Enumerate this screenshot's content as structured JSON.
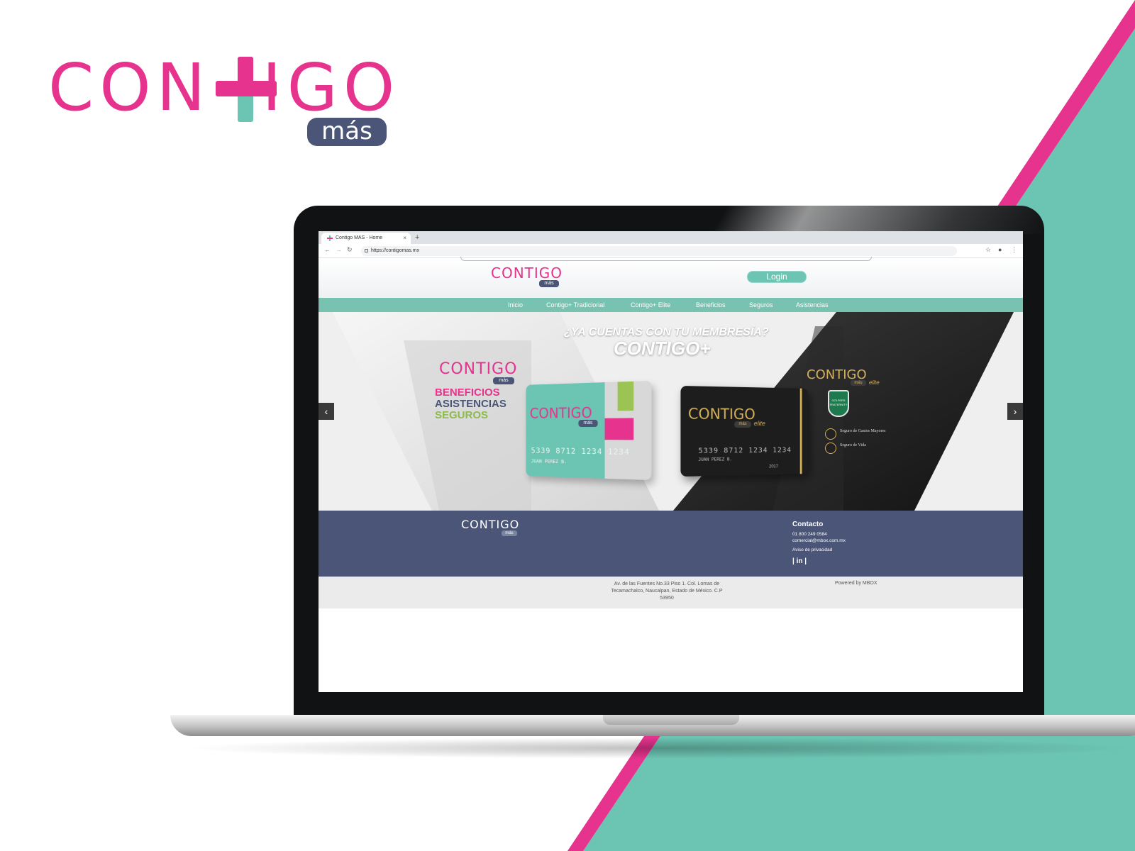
{
  "brand": {
    "word_left": "CON",
    "word_right": "IGO",
    "sub": "más"
  },
  "colors": {
    "pink": "#e5338e",
    "teal": "#6cc4b3",
    "navy": "#4a5577",
    "nav_teal": "#77c2b0",
    "gold": "#d4b05a"
  },
  "browser": {
    "tab_title": "Contigo MAS - Home",
    "tab_close": "×",
    "new_tab": "+",
    "url": "https://contigomas.mx",
    "icons": [
      "back-arrow-icon",
      "forward-arrow-icon",
      "reload-icon",
      "lock-icon",
      "star-icon",
      "account-icon",
      "menu-dots-icon"
    ]
  },
  "site": {
    "logo": "CONTIGO",
    "logo_sub": "más",
    "login": "Login",
    "nav": [
      "Inicio",
      "Contigo+ Tradicional",
      "Contigo+ Elite",
      "Beneficios",
      "Seguros",
      "Asistencias"
    ]
  },
  "hero": {
    "question": "¿YA CUENTAS CON TU MEMBRESÍA?",
    "title": "CONTIGO+",
    "left_logo": "CONTIGO",
    "left_sub": "más",
    "benefits": [
      "BENEFICIOS",
      "ASISTENCIAS",
      "SEGUROS"
    ],
    "teal_card": {
      "logo": "CONTIGO",
      "sub": "más",
      "number": "5339 8712 1234 1234",
      "name": "JUAN PEREZ B."
    },
    "black_card": {
      "logo": "CONTIGO",
      "sub": "más",
      "tier": "elite",
      "number": "5339 8712 1234 1234",
      "name": "JUAN PEREZ B.",
      "year": "2017"
    },
    "right_logo": "CONTIGO",
    "right_sub": "más",
    "right_tier": "elite",
    "golf_badge": "GOLFERS FRATERNITY",
    "insurance": [
      "Seguro de Gastos Mayores",
      "Seguro de Vida"
    ],
    "prev": "‹",
    "next": "›"
  },
  "footer": {
    "logo": "CONTIGO",
    "logo_sub": "más",
    "contact_title": "Contacto",
    "phone": "01 800 249 0584",
    "email": "comercial@mbox.com.mx",
    "privacy": "Aviso de privacidad",
    "social": "| in |",
    "address": "Av. de las Fuentes No.33 Piso 1. Col. Lomas de Tecamachalco, Naucalpan, Estado de México. C.P 53950",
    "powered": "Powered by MBOX"
  }
}
